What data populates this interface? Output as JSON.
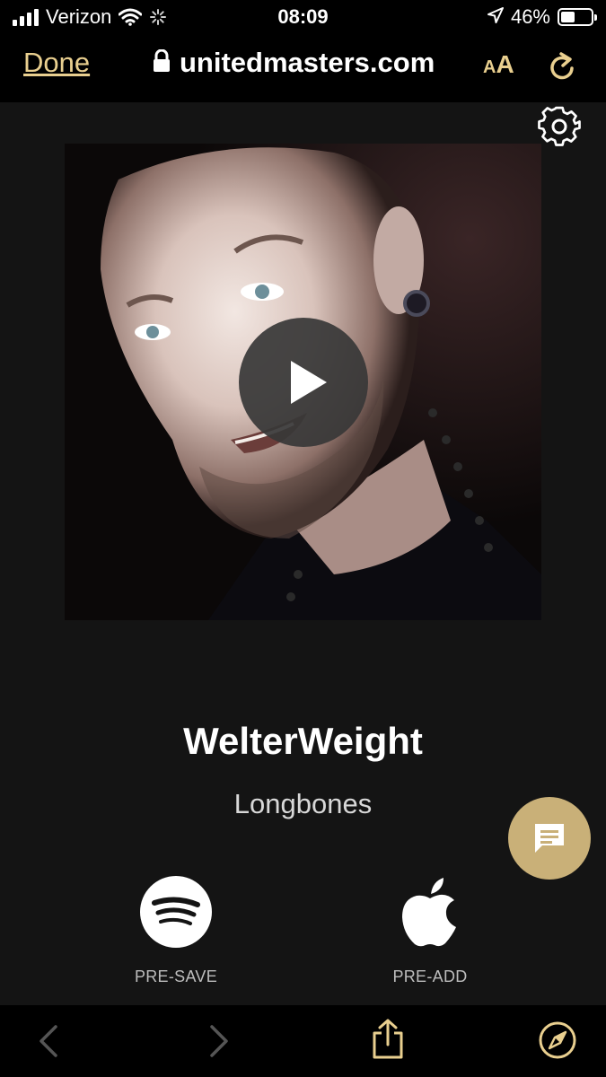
{
  "status_bar": {
    "carrier": "Verizon",
    "time": "08:09",
    "battery_percent": "46%",
    "battery_level": 0.46,
    "icons": [
      "signal-icon",
      "wifi-icon",
      "loading-spinner-icon",
      "location-arrow-icon",
      "battery-icon"
    ]
  },
  "browser": {
    "done_label": "Done",
    "url": "unitedmasters.com",
    "text_size_label_small": "A",
    "text_size_label_big": "A",
    "icons": [
      "lock-icon",
      "reload-icon"
    ]
  },
  "track": {
    "title": "WelterWeight",
    "artist": "Longbones"
  },
  "services": [
    {
      "name": "spotify",
      "label": "PRE-SAVE",
      "icon": "spotify-icon"
    },
    {
      "name": "apple",
      "label": "PRE-ADD",
      "icon": "apple-icon"
    }
  ],
  "toolbar": {
    "icons": [
      "back-arrow-icon",
      "forward-arrow-icon",
      "share-icon",
      "compass-icon"
    ]
  },
  "colors": {
    "accent_gold": "#e9cf8f",
    "chat_button": "#c9b078",
    "background": "#141414",
    "bars": "#000000"
  }
}
